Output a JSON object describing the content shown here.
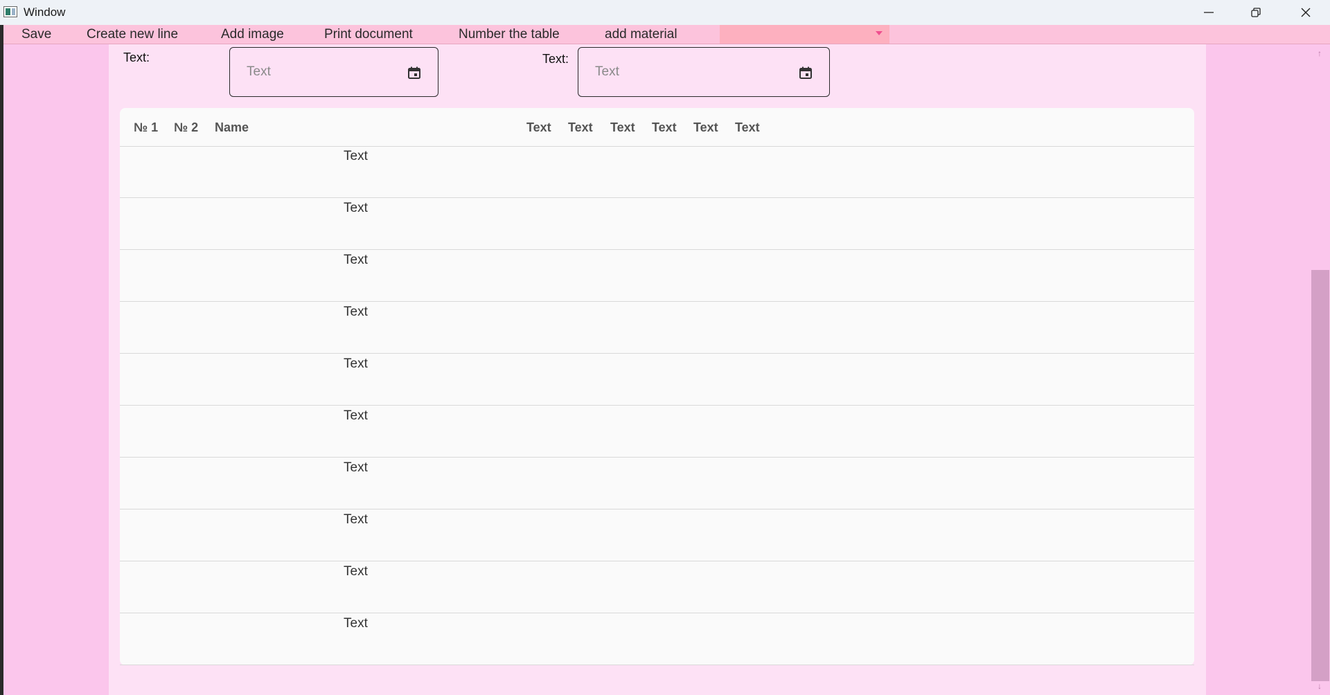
{
  "window": {
    "title": "Window"
  },
  "menu": {
    "items": [
      {
        "label": "Save"
      },
      {
        "label": "Create new line"
      },
      {
        "label": "Add image"
      },
      {
        "label": "Print document"
      },
      {
        "label": "Number the table"
      },
      {
        "label": "add material"
      }
    ],
    "combo_value": ""
  },
  "form": {
    "field1": {
      "label": "Text:",
      "placeholder": "Text"
    },
    "field2": {
      "label": "Text:",
      "placeholder": "Text"
    }
  },
  "table": {
    "columns": [
      "№ 1",
      "№ 2",
      "Name",
      "Text",
      "Text",
      "Text",
      "Text",
      "Text",
      "Text"
    ],
    "rows": [
      {
        "name": "Text"
      },
      {
        "name": "Text"
      },
      {
        "name": "Text"
      },
      {
        "name": "Text"
      },
      {
        "name": "Text"
      },
      {
        "name": "Text"
      },
      {
        "name": "Text"
      },
      {
        "name": "Text"
      },
      {
        "name": "Text"
      },
      {
        "name": "Text"
      }
    ]
  },
  "colors": {
    "background": "#fbc6ec",
    "menubar": "#fcc3dc",
    "combo": "#fdb0bf",
    "content": "#fde1f5",
    "table": "#fafafa",
    "accent": "#ef4f8f"
  },
  "icons": {
    "app": "app-window-icon",
    "minimize": "minimize-icon",
    "maximize": "restore-icon",
    "close": "close-icon",
    "date_picker": "calendar-icon",
    "combo": "chevron-down-icon"
  }
}
